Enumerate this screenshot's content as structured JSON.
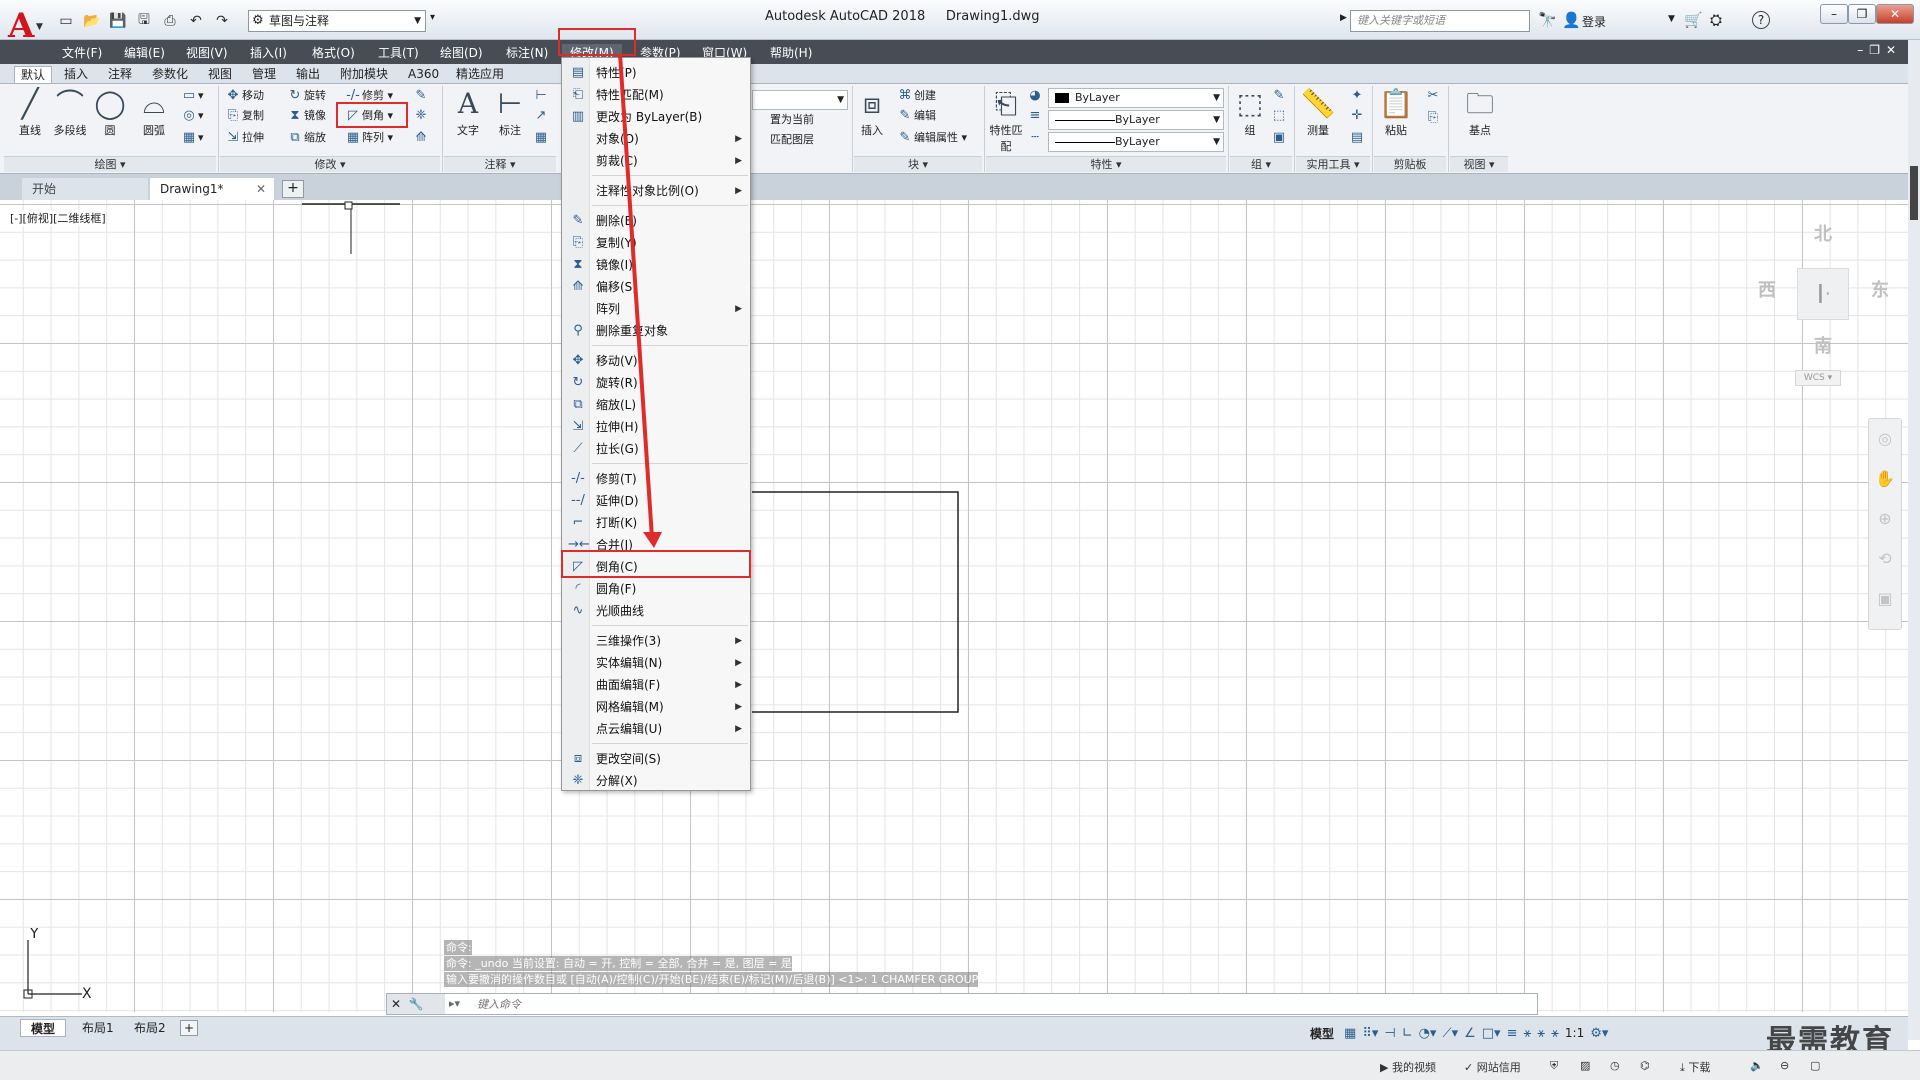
{
  "app": {
    "logo_letter": "A",
    "title": "Autodesk AutoCAD 2018",
    "doc_title": "Drawing1.dwg",
    "workspace": "草图与注释",
    "search_placeholder": "键入关键字或短语",
    "login": "登录",
    "help": "?"
  },
  "menubar": {
    "items": [
      "文件(F)",
      "编辑(E)",
      "视图(V)",
      "插入(I)",
      "格式(O)",
      "工具(T)",
      "绘图(D)",
      "标注(N)",
      "修改(M)",
      "参数(P)",
      "窗口(W)",
      "帮助(H)"
    ],
    "active": "修改(M)"
  },
  "ribbon_tabs": [
    "默认",
    "插入",
    "注释",
    "参数化",
    "视图",
    "管理",
    "输出",
    "附加模块",
    "A360",
    "精选应用"
  ],
  "ribbon": {
    "draw": {
      "title": "绘图",
      "line": "直线",
      "polyline": "多段线",
      "circle": "圆",
      "arc": "圆弧"
    },
    "modify": {
      "title": "修改",
      "move": "移动",
      "rotate": "旋转",
      "trim": "修剪",
      "copy": "复制",
      "mirror": "镜像",
      "chamfer": "倒角",
      "stretch": "拉伸",
      "scale": "缩放",
      "array": "阵列"
    },
    "annotation": {
      "title": "注释",
      "text": "文字",
      "dim": "标注"
    },
    "layers": {
      "make_current": "置为当前",
      "match": "匹配图层"
    },
    "block": {
      "title": "块",
      "insert": "插入",
      "create": "创建",
      "edit": "编辑",
      "edit_attr": "编辑属性"
    },
    "properties": {
      "title": "特性",
      "match": "特性匹配",
      "color": "ByLayer",
      "linetype": "ByLayer",
      "lineweight": "ByLayer"
    },
    "groups": {
      "title": "组",
      "group": "组"
    },
    "utilities": {
      "title": "实用工具",
      "measure": "测量"
    },
    "clipboard": {
      "title": "剪贴板",
      "paste": "粘贴"
    },
    "view": {
      "title": "视图",
      "base": "基点"
    }
  },
  "file_tabs": {
    "start": "开始",
    "drawing": "Drawing1*"
  },
  "viewport_label": "[-][俯视][二维线框]",
  "viewcube": {
    "north": "北",
    "south": "南",
    "east": "东",
    "west": "西",
    "wcs": "WCS"
  },
  "modify_menu": {
    "items": [
      {
        "label": "特性(P)",
        "icon": "properties-icon"
      },
      {
        "label": "特性匹配(M)",
        "icon": "match-properties-icon"
      },
      {
        "label": "更改为 ByLayer(B)",
        "icon": "bylayer-icon"
      },
      {
        "label": "对象(O)",
        "sub": true
      },
      {
        "label": "剪裁(C)",
        "sub": true
      },
      {
        "sep": true
      },
      {
        "label": "注释性对象比例(O)",
        "sub": true
      },
      {
        "sep": true
      },
      {
        "label": "删除(E)",
        "icon": "erase-icon"
      },
      {
        "label": "复制(Y)",
        "icon": "copy-icon"
      },
      {
        "label": "镜像(I)",
        "icon": "mirror-icon"
      },
      {
        "label": "偏移(S)",
        "icon": "offset-icon"
      },
      {
        "label": "阵列",
        "sub": true
      },
      {
        "label": "删除重复对象",
        "icon": "overkill-icon"
      },
      {
        "sep": true
      },
      {
        "label": "移动(V)",
        "icon": "move-icon"
      },
      {
        "label": "旋转(R)",
        "icon": "rotate-icon"
      },
      {
        "label": "缩放(L)",
        "icon": "scale-icon"
      },
      {
        "label": "拉伸(H)",
        "icon": "stretch-icon"
      },
      {
        "label": "拉长(G)",
        "icon": "lengthen-icon"
      },
      {
        "sep": true
      },
      {
        "label": "修剪(T)",
        "icon": "trim-icon"
      },
      {
        "label": "延伸(D)",
        "icon": "extend-icon"
      },
      {
        "label": "打断(K)",
        "icon": "break-icon"
      },
      {
        "label": "合并(J)",
        "icon": "join-icon"
      },
      {
        "label": "倒角(C)",
        "icon": "chamfer-icon"
      },
      {
        "label": "圆角(F)",
        "icon": "fillet-icon"
      },
      {
        "label": "光顺曲线",
        "icon": "blend-curve-icon"
      },
      {
        "sep": true
      },
      {
        "label": "三维操作(3)",
        "sub": true
      },
      {
        "label": "实体编辑(N)",
        "sub": true
      },
      {
        "label": "曲面编辑(F)",
        "sub": true
      },
      {
        "label": "网格编辑(M)",
        "sub": true
      },
      {
        "label": "点云编辑(U)",
        "sub": true
      },
      {
        "sep": true
      },
      {
        "label": "更改空间(S)",
        "icon": "change-space-icon"
      },
      {
        "label": "分解(X)",
        "icon": "explode-icon"
      }
    ]
  },
  "command": {
    "history": [
      "命令:",
      "命令:  _undo 当前设置: 自动 = 开, 控制 = 全部, 合并 = 是, 图层 = 是",
      "输入要撤消的操作数目或 [自动(A)/控制(C)/开始(BE)/结束(E)/标记(M)/后退(B)] <1>: 1 CHAMFER GROUP"
    ],
    "placeholder": "键入命令"
  },
  "layout_tabs": [
    "模型",
    "布局1",
    "布局2"
  ],
  "status": {
    "model": "模型",
    "scale": "1:1"
  },
  "taskbar": {
    "video": "我的视频",
    "credit": "网站信用",
    "download": "下载"
  },
  "watermark": "最需教育"
}
